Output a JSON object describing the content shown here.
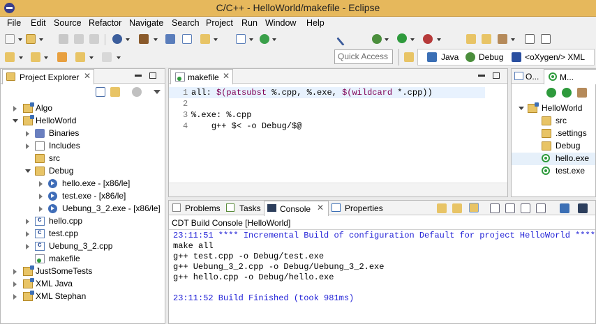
{
  "window": {
    "title": "C/C++ - HelloWorld/makefile - Eclipse"
  },
  "menu": [
    "File",
    "Edit",
    "Source",
    "Refactor",
    "Navigate",
    "Search",
    "Project",
    "Run",
    "Window",
    "Help"
  ],
  "toolbar": {
    "quick_access_placeholder": "Quick Access",
    "perspectives": [
      "Java",
      "Debug",
      "<oXygen/> XML"
    ]
  },
  "project_explorer": {
    "tab_label": "Project Explorer",
    "tree": [
      {
        "label": "Algo"
      },
      {
        "label": "HelloWorld"
      },
      {
        "label": "Binaries"
      },
      {
        "label": "Includes"
      },
      {
        "label": "src"
      },
      {
        "label": "Debug"
      },
      {
        "label": "hello.exe - [x86/le]"
      },
      {
        "label": "test.exe - [x86/le]"
      },
      {
        "label": "Uebung_3_2.exe - [x86/le]"
      },
      {
        "label": "hello.cpp"
      },
      {
        "label": "test.cpp"
      },
      {
        "label": "Uebung_3_2.cpp"
      },
      {
        "label": "makefile"
      },
      {
        "label": "JustSomeTests"
      },
      {
        "label": "XML Java"
      },
      {
        "label": "XML Stephan"
      }
    ]
  },
  "editor": {
    "tab_label": "makefile",
    "line_numbers": [
      "1",
      "2",
      "3",
      "4"
    ],
    "lines": [
      {
        "a": "all: ",
        "b": "$(patsubst ",
        "c": "%.cpp, %.exe, ",
        "d": "$(wildcard ",
        "e": "*.cpp))"
      },
      {
        "text": ""
      },
      {
        "text": "%.exe: %.cpp"
      },
      {
        "text": "\tg++ $< -o Debug/$@"
      }
    ]
  },
  "right_view": {
    "tab_outline": "O...",
    "tab_make": "M...",
    "tree": [
      {
        "label": "HelloWorld"
      },
      {
        "label": "src"
      },
      {
        "label": ".settings"
      },
      {
        "label": "Debug"
      },
      {
        "label": "hello.exe"
      },
      {
        "label": "test.exe"
      }
    ]
  },
  "bottom_tabs": [
    "Problems",
    "Tasks",
    "Console",
    "Properties"
  ],
  "console": {
    "header": "CDT Build Console [HelloWorld]",
    "lines": [
      "23:11:51 **** Incremental Build of configuration Default for project HelloWorld ****",
      "make all",
      "g++ test.cpp -o Debug/test.exe",
      "g++ Uebung_3_2.cpp -o Debug/Uebung_3_2.exe",
      "g++ hello.cpp -o Debug/hello.exe",
      "",
      "23:11:52 Build Finished (took 981ms)"
    ]
  },
  "colors": {
    "titlebar": "#e6b85c",
    "console_info": "#1f1fd6",
    "keyword": "#7f0055"
  }
}
